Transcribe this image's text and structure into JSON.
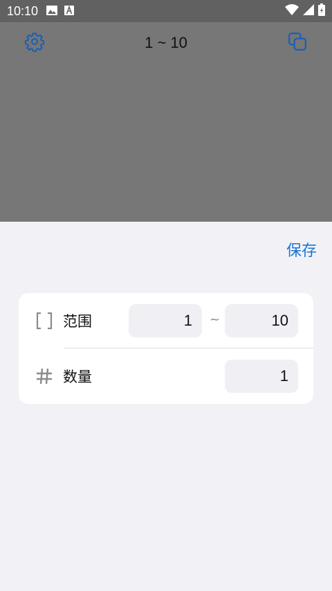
{
  "statusbar": {
    "time": "10:10",
    "left_icons": [
      "image-icon",
      "a-icon"
    ],
    "right_icons": [
      "wifi-icon",
      "signal-icon",
      "battery-icon"
    ]
  },
  "topbar": {
    "title": "1 ~ 10",
    "left_icon": "gear-icon",
    "right_icon": "copy-icon"
  },
  "sheet": {
    "save_label": "保存",
    "range": {
      "label": "范围",
      "min_value": "1",
      "separator": "~",
      "max_value": "10"
    },
    "count": {
      "label": "数量",
      "value": "1"
    }
  },
  "colors": {
    "accent": "#1a73d9",
    "backdrop": "#777777",
    "sheet_bg": "#f2f2f6"
  }
}
